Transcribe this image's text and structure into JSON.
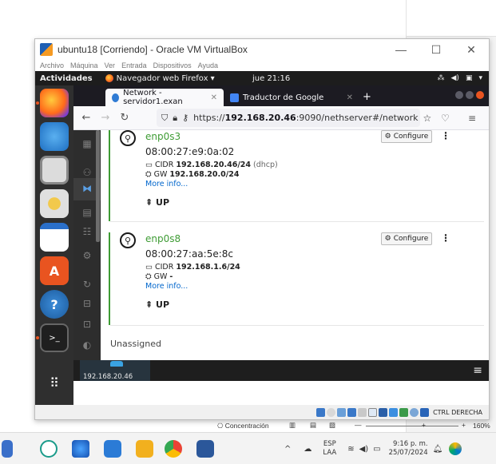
{
  "vbox": {
    "title": "ubuntu18 [Corriendo] - Oracle VM VirtualBox",
    "controls": [
      "—",
      "☐",
      "✕"
    ],
    "menu": [
      "Archivo",
      "Máquina",
      "Ver",
      "Entrada",
      "Dispositivos",
      "Ayuda"
    ],
    "status_right": "CTRL DERECHA"
  },
  "gnome": {
    "activities": "Actividades",
    "app_menu": "Navegador web Firefox ▾",
    "clock": "jue 21:16"
  },
  "firefox": {
    "tabs": [
      {
        "label": "Network - servidor1.exan",
        "active": true
      },
      {
        "label": "Traductor de Google",
        "active": false
      }
    ],
    "url_prefix": "https://",
    "url_host": "192.168.20.46",
    "url_path": ":9090/nethserver#/network"
  },
  "network": {
    "interfaces": [
      {
        "name": "enp0s3",
        "mac": "08:00:27:e9:0a:02",
        "cidr_label": "CIDR",
        "cidr": "192.168.20.46/24",
        "cidr_note": "(dhcp)",
        "gw_label": "GW",
        "gw": "192.168.20.0/24",
        "more": "More info...",
        "status": "UP",
        "configure": "Configure"
      },
      {
        "name": "enp0s8",
        "mac": "08:00:27:aa:5e:8c",
        "cidr_label": "CIDR",
        "cidr": "192.168.1.6/24",
        "cidr_note": "",
        "gw_label": "GW",
        "gw": "-",
        "more": "More info...",
        "status": "UP",
        "configure": "Configure"
      }
    ],
    "unassigned": "Unassigned",
    "server_ip": "192.168.20.46"
  },
  "host": {
    "concentration": "Concentración",
    "zoom": "160%",
    "lang_top": "ESP",
    "lang_bottom": "LAA",
    "time": "9:16 p. m.",
    "date": "25/07/2024"
  },
  "colors": {
    "ubuntu_orange": "#e95420",
    "link_green": "#3f9c35",
    "vm_blue": "#3aa3e3"
  }
}
